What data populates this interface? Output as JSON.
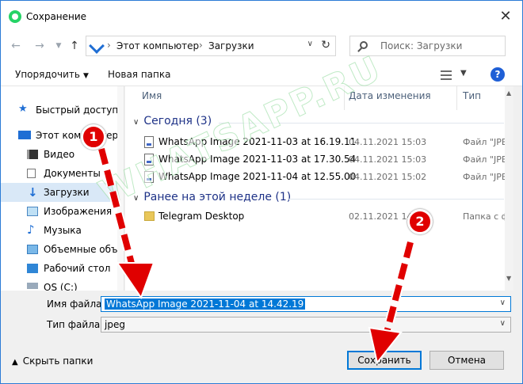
{
  "window": {
    "title": "Сохранение",
    "close": "✕"
  },
  "nav": {
    "breadcrumb": [
      "Этот компьютер",
      "Загрузки"
    ],
    "search_placeholder": "Поиск: Загрузки"
  },
  "toolbar": {
    "organize": "Упорядочить",
    "new_folder": "Новая папка",
    "help": "?"
  },
  "sidebar": {
    "items": [
      {
        "label": "Быстрый доступ",
        "icon": "star-icon"
      },
      {
        "label": "Этот компьютер",
        "icon": "computer-icon"
      },
      {
        "label": "Видео",
        "icon": "video-icon"
      },
      {
        "label": "Документы",
        "icon": "documents-icon"
      },
      {
        "label": "Загрузки",
        "icon": "downloads-icon",
        "selected": true
      },
      {
        "label": "Изображения",
        "icon": "pictures-icon"
      },
      {
        "label": "Музыка",
        "icon": "music-icon"
      },
      {
        "label": "Объемные объ",
        "icon": "3d-objects-icon"
      },
      {
        "label": "Рабочий стол",
        "icon": "desktop-icon"
      },
      {
        "label": "OS (C:)",
        "icon": "drive-icon"
      }
    ]
  },
  "list": {
    "columns": [
      "Имя",
      "Дата изменения",
      "Тип"
    ],
    "groups": [
      {
        "title": "Сегодня (3)",
        "rows": [
          {
            "name": "WhatsApp Image 2021-11-03 at 16.19.11",
            "date": "04.11.2021 15:03",
            "type": "Файл \"JPEG\""
          },
          {
            "name": "WhatsApp Image 2021-11-03 at 17.30.54",
            "date": "04.11.2021 15:03",
            "type": "Файл \"JPEG\""
          },
          {
            "name": "WhatsApp Image 2021-11-04 at 12.55.00",
            "date": "04.11.2021 15:02",
            "type": "Файл \"JPEG\""
          }
        ]
      },
      {
        "title": "Ранее на этой неделе (1)",
        "rows": [
          {
            "name": "Telegram Desktop",
            "date": "02.11.2021 14:",
            "type": "Папка с фа"
          }
        ]
      }
    ]
  },
  "form": {
    "filename_label": "Имя файла:",
    "filename_value": "WhatsApp Image 2021-11-04 at 14.42.19",
    "filetype_label": "Тип файла:",
    "filetype_value": "jpeg"
  },
  "bottom": {
    "hide_folders": "Скрыть папки",
    "save": "Сохранить",
    "cancel": "Отмена"
  },
  "annotations": {
    "badge1": "1",
    "badge2": "2",
    "watermark": "WHATSAPP.RU"
  },
  "colors": {
    "accent": "#0078d7",
    "arrow": "#e00000",
    "group_title": "#1e3287"
  }
}
